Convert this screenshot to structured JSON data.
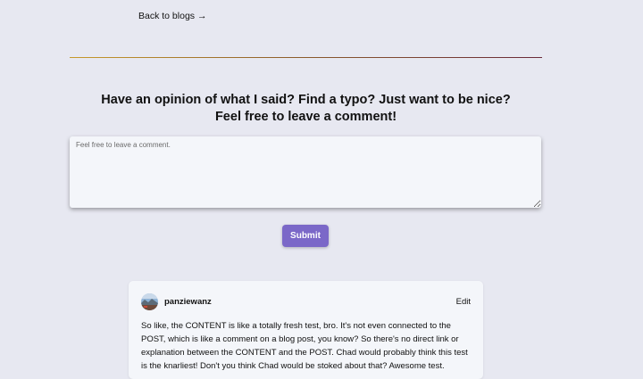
{
  "nav": {
    "back_label": "Back to blogs",
    "back_arrow": "→"
  },
  "comment_form": {
    "heading_line1": "Have an opinion of what I said? Find a typo? Just want to be nice?",
    "heading_line2": "Feel free to leave a comment!",
    "placeholder": "Feel free to leave a comment.",
    "value": "",
    "submit_label": "Submit"
  },
  "comments": [
    {
      "username": "panziewanz",
      "edit_label": "Edit",
      "body": "So like, the CONTENT is like a totally fresh test, bro. It's not even connected to the POST, which is like a comment on a blog post, you know? So there's no direct link or explanation between the CONTENT and the POST. Chad would probably think this test is the knarliest! Don't you think Chad would be stoked about that? Awesome test."
    }
  ],
  "colors": {
    "background": "#e7e8f1",
    "submit_button": "#7b68c8",
    "card_background": "#f4f6fa"
  }
}
